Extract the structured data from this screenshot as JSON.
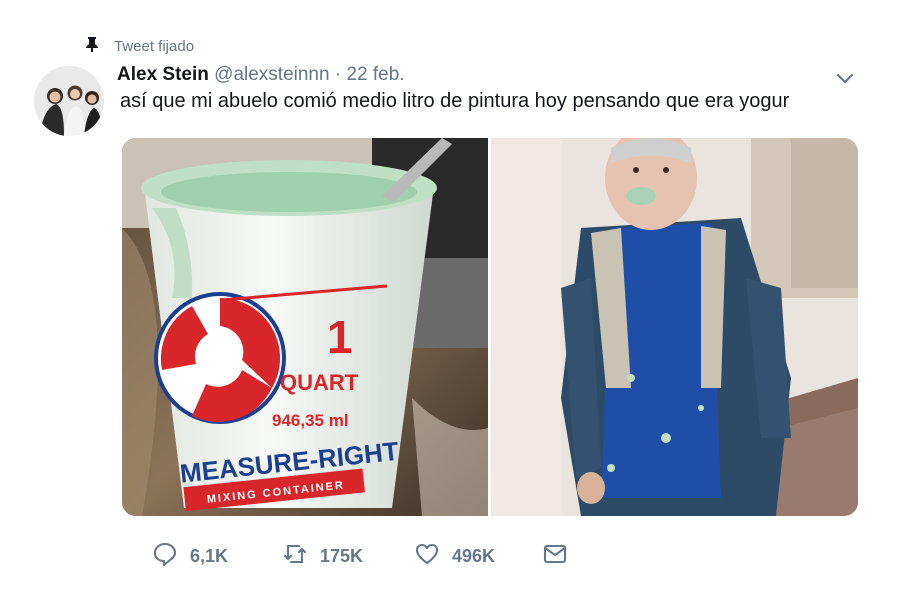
{
  "pinned": {
    "label": "Tweet fijado",
    "icon": "pin-icon"
  },
  "author": {
    "name": "Alex Stein",
    "handle": "@alexsteinnn",
    "separator": "·",
    "date": "22 feb."
  },
  "tweet": {
    "text": "así que mi abuelo comió medio litro de pintura hoy pensando que era yogur"
  },
  "media": {
    "left_photo": {
      "container_label_big": "1",
      "container_label_unit": "QUART",
      "container_label_ml": "946,35 ml",
      "brand": "MEASURE-RIGHT",
      "brand_sub": "MIXING CONTAINER"
    }
  },
  "actions": {
    "replies": "6,1K",
    "retweets": "175K",
    "likes": "496K"
  },
  "colors": {
    "secondary_text": "#657786",
    "primary_text": "#14171a",
    "paint_green": "#a9d3b4",
    "brand_red": "#d9262b",
    "brand_blue": "#1d3f8f"
  }
}
